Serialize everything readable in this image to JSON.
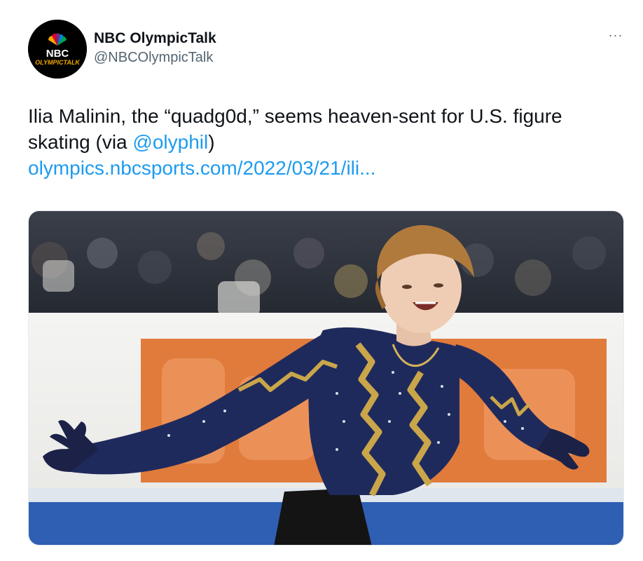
{
  "account": {
    "display_name": "NBC OlympicTalk",
    "handle": "@NBCOlympicTalk",
    "avatar_text_top": "NBC",
    "avatar_text_bottom": "OLYMPICTALK"
  },
  "more_label": "···",
  "tweet": {
    "text_part1": "Ilia Malinin, the “quadg0d,” seems heaven-sent for U.S. figure skating  (via ",
    "mention": "@olyphil",
    "text_part2": ")",
    "url": "olympics.nbcsports.com/2022/03/21/ili..."
  },
  "media": {
    "icon": "photo",
    "colors": {
      "costume": "#1f2a5c",
      "gold": "#c9a64a",
      "banner": "#e07b3c",
      "ice_stripe": "#2f5fb3"
    }
  }
}
